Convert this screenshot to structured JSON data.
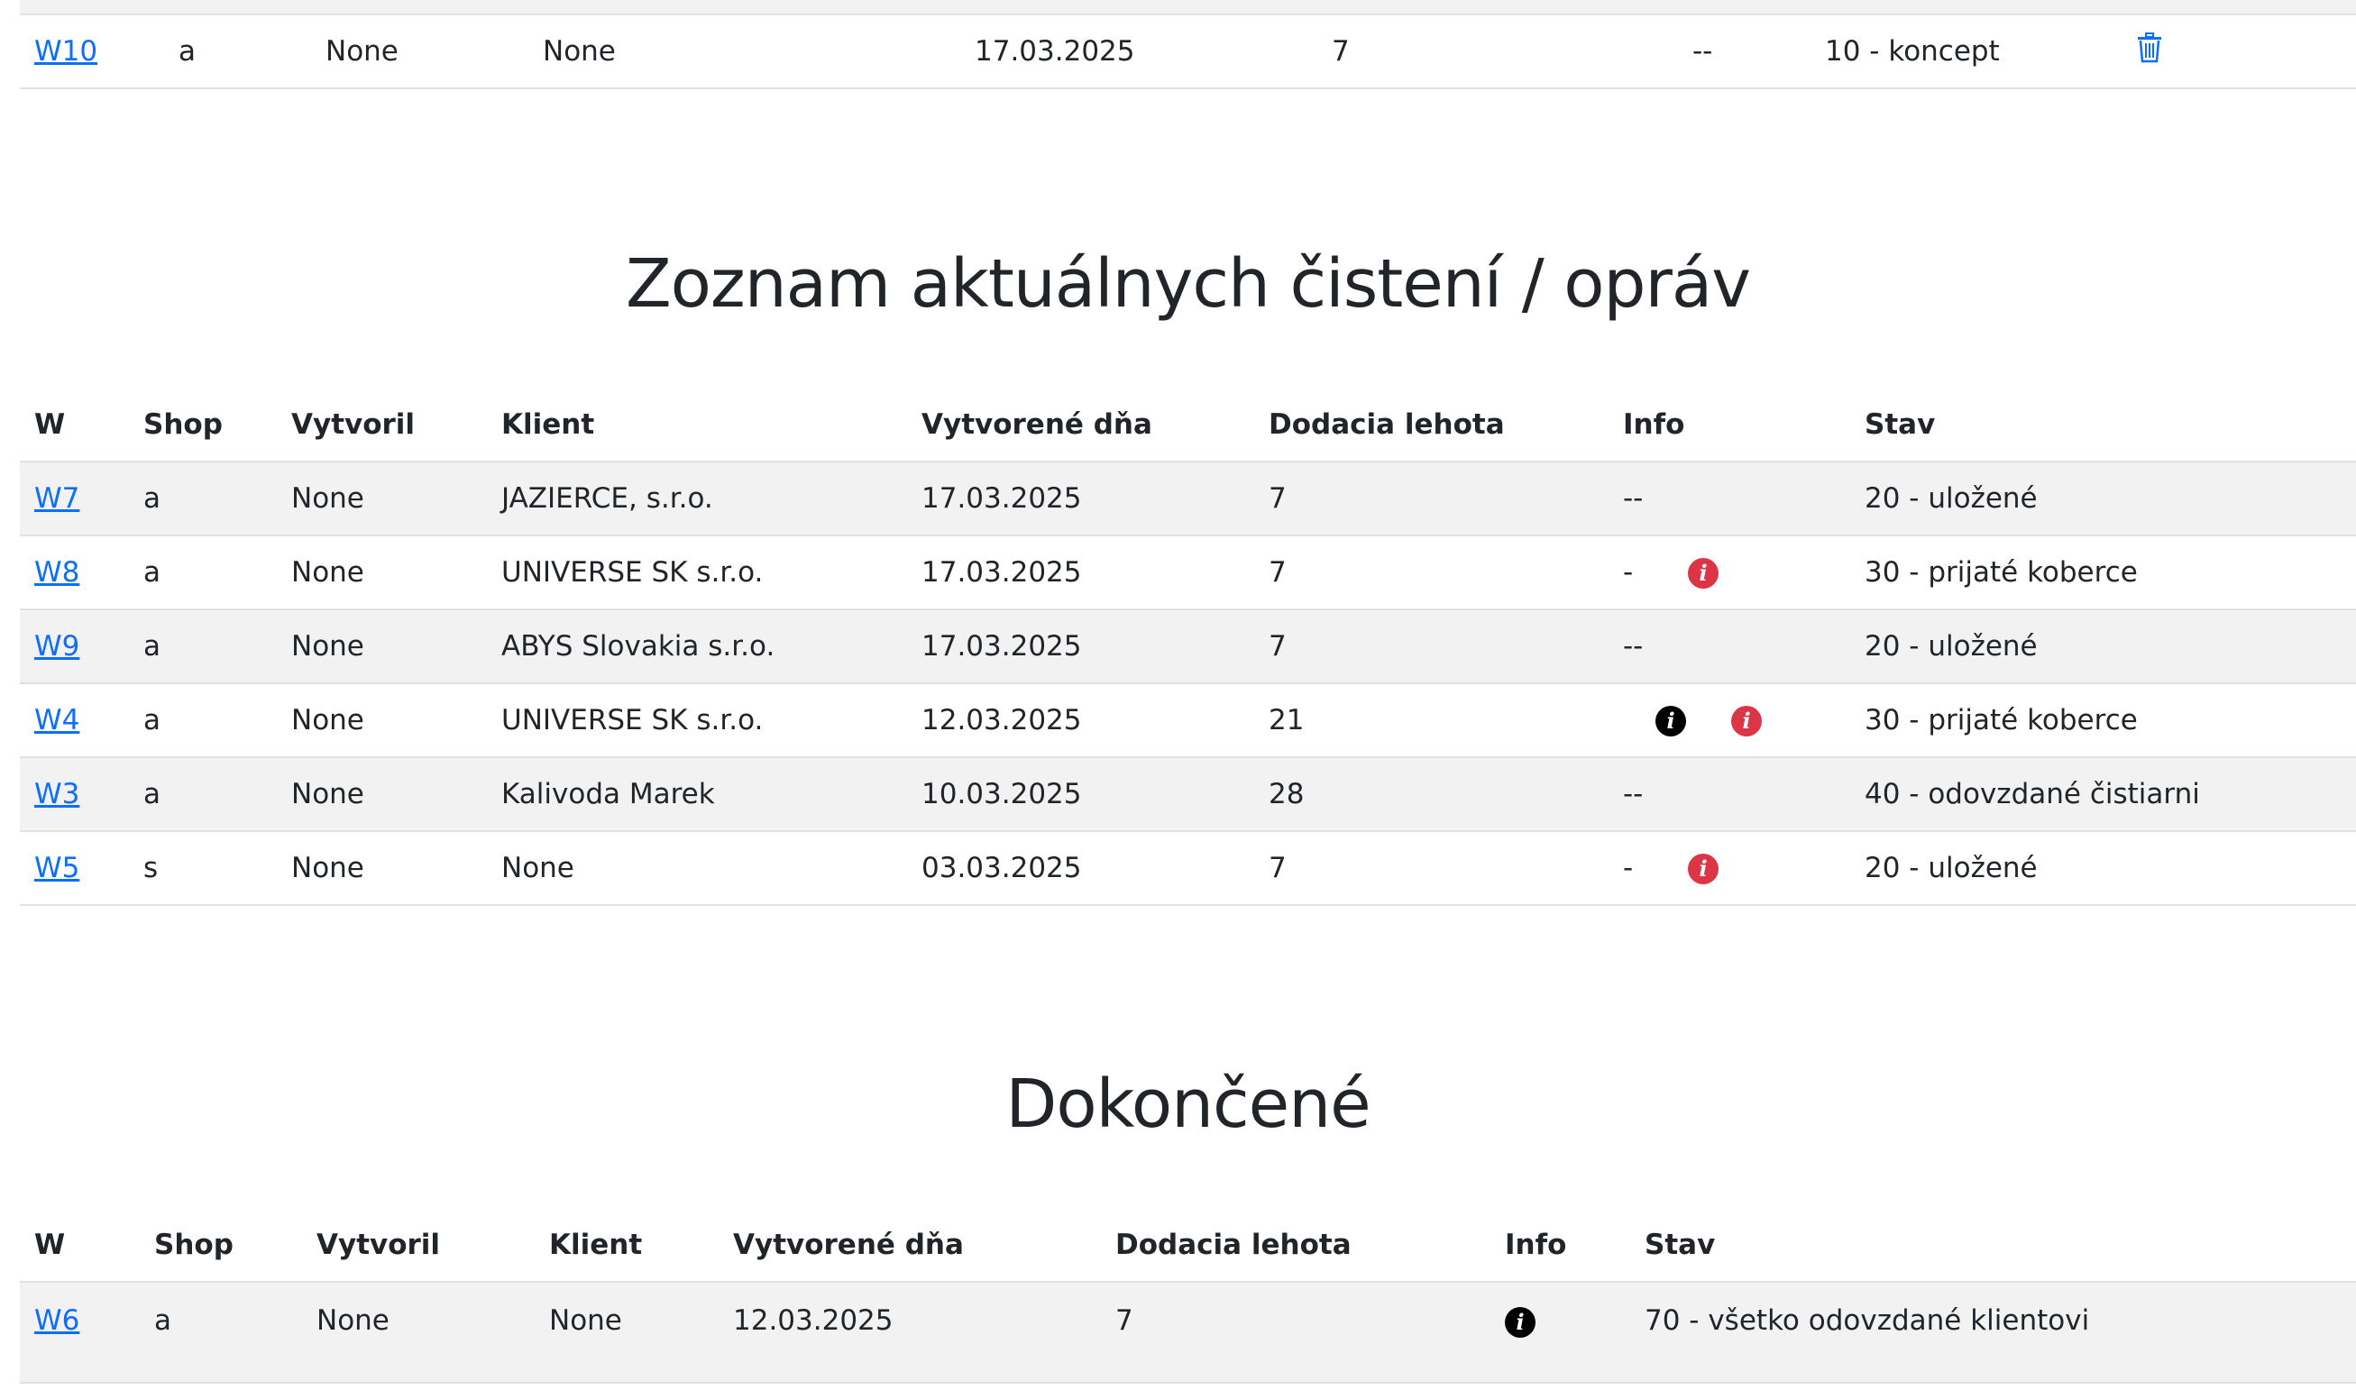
{
  "colors": {
    "link": "#0d6efd",
    "info_red": "#dc3545",
    "info_black": "#000000",
    "stripe": "#f2f2f2"
  },
  "top_table": {
    "row": {
      "w": "W10",
      "shop": "a",
      "vytvoril": "None",
      "klient": "None",
      "date": "17.03.2025",
      "lehota": "7",
      "info": "--",
      "stav": "10 - koncept",
      "delete_icon": "trash-icon"
    }
  },
  "current": {
    "title": "Zoznam aktuálnych čistení / opráv",
    "headers": {
      "w": "W",
      "shop": "Shop",
      "vytvoril": "Vytvoril",
      "klient": "Klient",
      "date": "Vytvorené dňa",
      "lehota": "Dodacia lehota",
      "info": "Info",
      "stav": "Stav"
    },
    "rows": [
      {
        "w": "W7",
        "shop": "a",
        "vytvoril": "None",
        "klient": "JAZIERCE, s.r.o.",
        "date": "17.03.2025",
        "lehota": "7",
        "info_text": "--",
        "stav": "20 - uložené"
      },
      {
        "w": "W8",
        "shop": "a",
        "vytvoril": "None",
        "klient": "UNIVERSE SK s.r.o.",
        "date": "17.03.2025",
        "lehota": "7",
        "info_text": "-",
        "stav": "30 - prijaté koberce"
      },
      {
        "w": "W9",
        "shop": "a",
        "vytvoril": "None",
        "klient": "ABYS Slovakia s.r.o.",
        "date": "17.03.2025",
        "lehota": "7",
        "info_text": "--",
        "stav": "20 - uložené"
      },
      {
        "w": "W4",
        "shop": "a",
        "vytvoril": "None",
        "klient": "UNIVERSE SK s.r.o.",
        "date": "12.03.2025",
        "lehota": "21",
        "info_text": "",
        "stav": "30 - prijaté koberce"
      },
      {
        "w": "W3",
        "shop": "a",
        "vytvoril": "None",
        "klient": "Kalivoda Marek",
        "date": "10.03.2025",
        "lehota": "28",
        "info_text": "--",
        "stav": "40 - odovzdané čistiarni"
      },
      {
        "w": "W5",
        "shop": "s",
        "vytvoril": "None",
        "klient": "None",
        "date": "03.03.2025",
        "lehota": "7",
        "info_text": "-",
        "stav": "20 - uložené"
      }
    ],
    "info_glyph": "i"
  },
  "done": {
    "title": "Dokončené",
    "headers": {
      "w": "W",
      "shop": "Shop",
      "vytvoril": "Vytvoril",
      "klient": "Klient",
      "date": "Vytvorené dňa",
      "lehota": "Dodacia lehota",
      "info": "Info",
      "stav": "Stav"
    },
    "rows": [
      {
        "w": "W6",
        "shop": "a",
        "vytvoril": "None",
        "klient": "None",
        "date": "12.03.2025",
        "lehota": "7",
        "stav": "70 - všetko odovzdané klientovi"
      }
    ],
    "info_glyph": "i"
  }
}
